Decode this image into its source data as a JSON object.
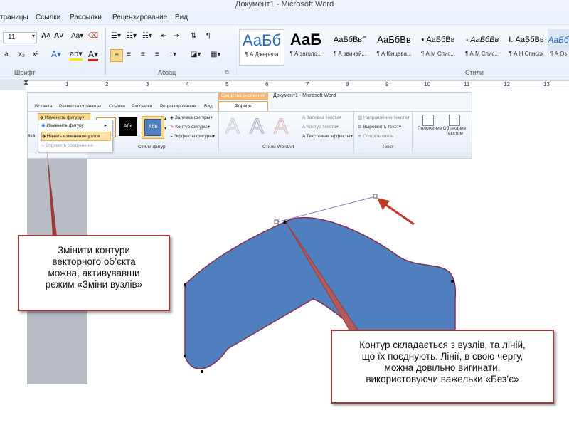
{
  "window": {
    "title": "Документ1 - Microsoft Word"
  },
  "tabs": [
    "траницы",
    "Ссылки",
    "Рассылки",
    "Рецензирование",
    "Вид"
  ],
  "ribbon": {
    "font_size": "11",
    "group_font": "Шрифт",
    "group_paragraph": "Абзац",
    "group_styles": "Стили",
    "styles": [
      {
        "preview": "АаБб",
        "label": "¶ А Джерела"
      },
      {
        "preview": "АаБ",
        "label": "¶ А заголо..."
      },
      {
        "preview": "АаБбВвГ",
        "label": "¶ А звичай..."
      },
      {
        "preview": "АаБбВв",
        "label": "¶ А Кінцева..."
      },
      {
        "preview": "• АаБбВв",
        "label": "¶ А М Спис..."
      },
      {
        "preview": "- АаБбВв",
        "label": "¶ А М Спис..."
      },
      {
        "preview": "I. АаБбВв",
        "label": "¶ А Н Список"
      },
      {
        "preview": "АаБб",
        "label": "¶ А Оз"
      }
    ]
  },
  "ruler": [
    "1",
    "2",
    "3",
    "4",
    "5",
    "6",
    "7",
    "8",
    "9",
    "10",
    "11",
    "12",
    "13"
  ],
  "inner": {
    "drawing_tools": "Средства рисования",
    "title": "Документ1 - Microsoft Word",
    "tabs": [
      "Вставка",
      "Разметка страницы",
      "Ссылки",
      "Рассылки",
      "Рецензирование",
      "Вид"
    ],
    "format_tab": "Формат",
    "edit_shape": "Изменить фигуру",
    "fill": "Заливка фигуры",
    "outline": "Контур фигуры",
    "effects": "Эффекты фигуры",
    "shape_styles": "Стили фигур",
    "wordart_styles": "Стили WordArt",
    "text_fill": "Заливка текста",
    "text_outline": "Контур текста",
    "text_effects": "Текстовые эффекты",
    "text_direction": "Направление текста",
    "align_text": "Выровнять текст",
    "create_link": "Создать связь",
    "text_group": "Текст",
    "position": "Положение",
    "wrap": "Обтекание текстом",
    "sample_text": "Абв",
    "wordart_letter": "A",
    "group_left": "вка"
  },
  "dropdown": {
    "items": [
      "Изменить фигуру",
      "Начать изменение узлов",
      "Спрямить соединения"
    ]
  },
  "callouts": {
    "left": [
      "Змінити  контури",
      "векторного об’єкта",
      "можна, активувавши",
      "режим «Зміни вузлів»"
    ],
    "right": [
      "Контур складається з вузлів, та ліній,",
      "що їх поєднують. Лінії, в свою чергу,",
      "можна довільно вигинати,",
      "використовуючи важельки «Без’є»"
    ]
  },
  "colors": {
    "shape_fill": "#4f7fbf",
    "shape_stroke": "#8a2c4c",
    "callout_border": "#9b3a3a",
    "arrow": "#c0392b",
    "handle_line": "#7b7fd8"
  }
}
